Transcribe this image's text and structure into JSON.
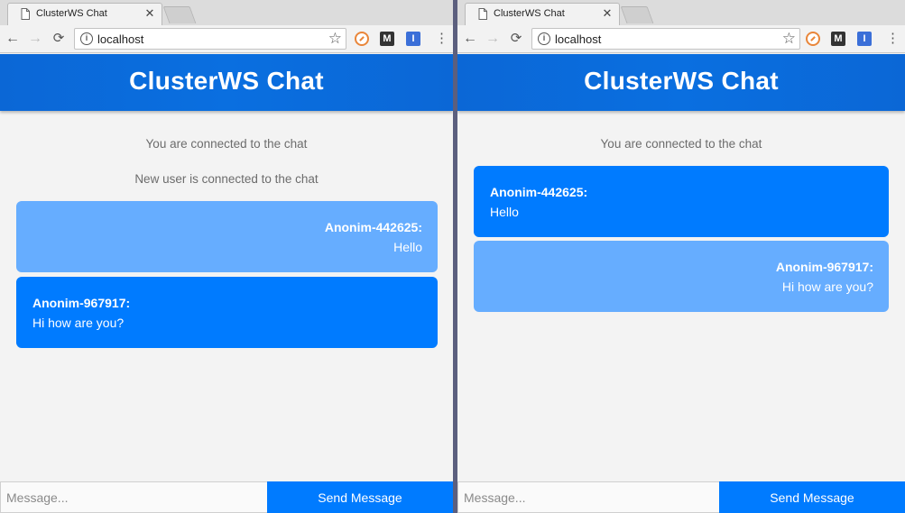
{
  "browser": {
    "tab_title": "ClusterWS Chat",
    "tab_close": "✕",
    "url": "localhost",
    "nav": {
      "back": "←",
      "forward": "→",
      "reload": "⟳"
    },
    "star": "☆",
    "extensions": {
      "m_label": "M",
      "i_label": "I"
    },
    "menu": "⋮"
  },
  "app": {
    "title": "ClusterWS Chat",
    "colors": {
      "header": "#0a6fe0",
      "own_bubble": "#007bff",
      "other_bubble": "#66adff",
      "send_button": "#007bff"
    }
  },
  "left_window": {
    "system_messages": [
      "You are connected to the chat",
      "New user is connected to the chat"
    ],
    "messages": [
      {
        "user": "Anonim-442625:",
        "text": "Hello",
        "side": "right"
      },
      {
        "user": "Anonim-967917:",
        "text": "Hi how are you?",
        "side": "left"
      }
    ],
    "composer": {
      "placeholder": "Message...",
      "value": "",
      "send_label": "Send Message"
    }
  },
  "right_window": {
    "system_messages": [
      "You are connected to the chat"
    ],
    "messages": [
      {
        "user": "Anonim-442625:",
        "text": "Hello",
        "side": "left"
      },
      {
        "user": "Anonim-967917:",
        "text": "Hi how are you?",
        "side": "right"
      }
    ],
    "composer": {
      "placeholder": "Message...",
      "value": "",
      "send_label": "Send Message"
    }
  }
}
